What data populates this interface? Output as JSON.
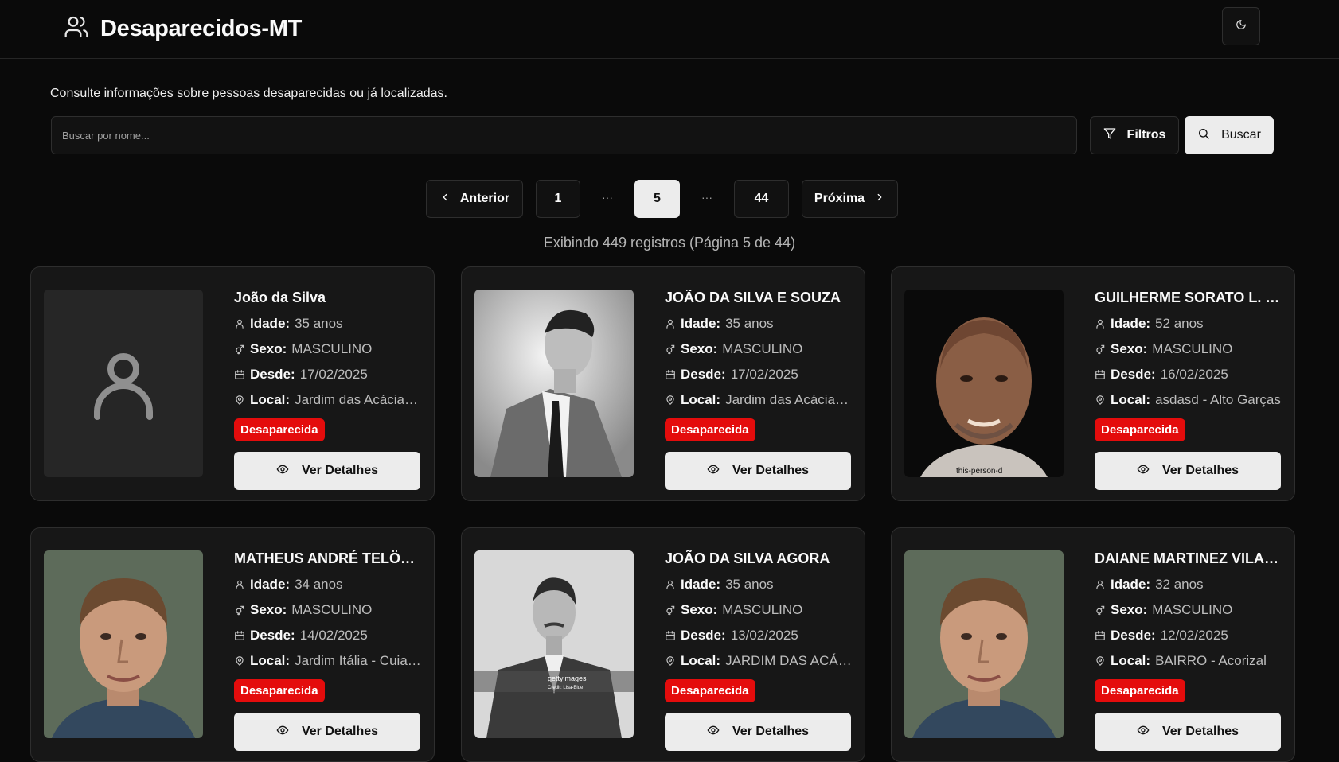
{
  "header": {
    "title": "Desaparecidos-MT"
  },
  "subtitle": "Consulte informações sobre pessoas desaparecidas ou já localizadas.",
  "search": {
    "placeholder": "Buscar por nome...",
    "value": ""
  },
  "buttons": {
    "filters": "Filtros",
    "search": "Buscar"
  },
  "pagination": {
    "prev": "Anterior",
    "pages": [
      "1",
      "5",
      "44"
    ],
    "current": "5",
    "ellipsis": "···",
    "next": "Próxima"
  },
  "records_text": "Exibindo 449 registros (Página 5 de 44)",
  "labels": {
    "age": "Idade:",
    "sex": "Sexo:",
    "since": "Desde:",
    "local": "Local:",
    "details": "Ver Detalhes"
  },
  "cards": [
    {
      "name": "João da Silva",
      "age": "35 anos",
      "sex": "MASCULINO",
      "since": "17/02/2025",
      "local": "Jardim das Acácias - Cuiabá",
      "status": "Desaparecida",
      "photo": "placeholder"
    },
    {
      "name": "JOÃO DA SILVA E SOUZA",
      "age": "35 anos",
      "sex": "MASCULINO",
      "since": "17/02/2025",
      "local": "Jardim das Acácias - Cuiabá",
      "status": "Desaparecida",
      "photo": "bw-man-profile"
    },
    {
      "name": "GUILHERME SORATO L. FERREIRA",
      "age": "52 anos",
      "sex": "MASCULINO",
      "since": "16/02/2025",
      "local": "asdasd - Alto Garças",
      "status": "Desaparecida",
      "photo": "man-portrait",
      "photo_caption": "this-person-d"
    },
    {
      "name": "MATHEUS ANDRÉ TELÖKEN",
      "age": "34 anos",
      "sex": "MASCULINO",
      "since": "14/02/2025",
      "local": "Jardim Itália - Cuiabá",
      "status": "Desaparecida",
      "photo": "man-portrait"
    },
    {
      "name": "JOÃO DA SILVA AGORA",
      "age": "35 anos",
      "sex": "MASCULINO",
      "since": "13/02/2025",
      "local": "JARDIM DAS ACÁCIAS - CUIABÁ",
      "status": "Desaparecida",
      "photo": "bw-man-vintage",
      "photo_caption": "gettyimages",
      "photo_credit": "Credit: Lisa-Blue"
    },
    {
      "name": "DAIANE MARTINEZ VILANOVA",
      "age": "32 anos",
      "sex": "MASCULINO",
      "since": "12/02/2025",
      "local": "BAIRRO - Acorizal",
      "status": "Desaparecida",
      "photo": "man-portrait"
    }
  ],
  "colors": {
    "background": "#0a0a0a",
    "card": "#171717",
    "status_red": "#e40c0c",
    "primary_button": "#ececec"
  }
}
